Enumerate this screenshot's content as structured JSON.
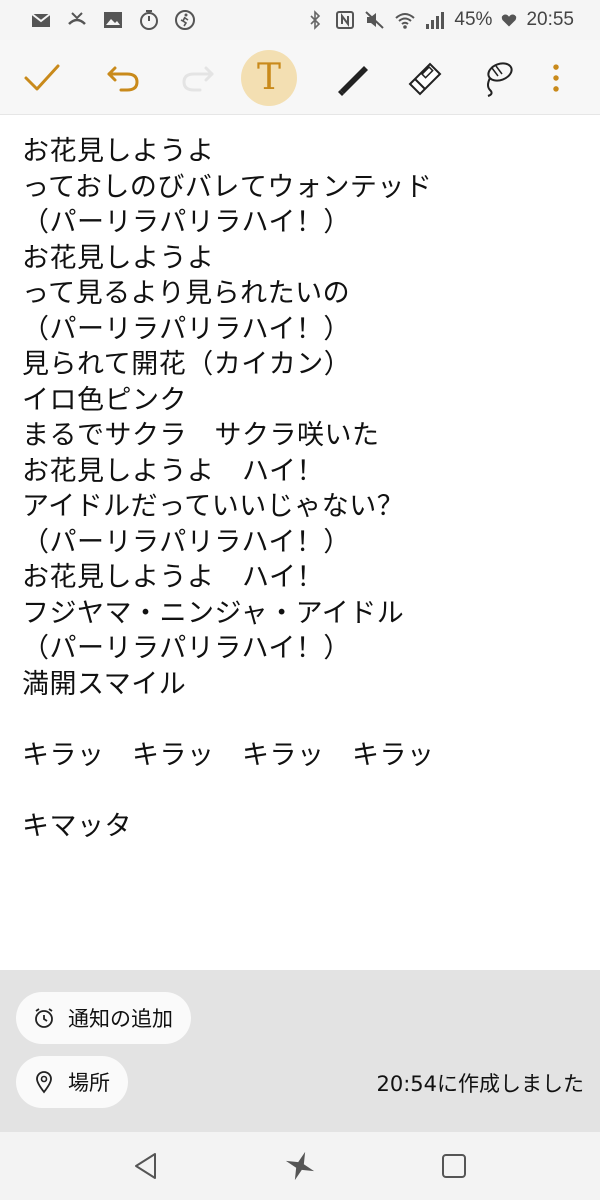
{
  "status_bar": {
    "battery_percent": "45%",
    "time": "20:55",
    "left_icons": [
      "mail-icon",
      "missed-call-icon",
      "image-icon",
      "timer-icon",
      "running-icon"
    ],
    "right_icons": [
      "bluetooth-icon",
      "nfc-icon",
      "mute-icon",
      "wifi-icon",
      "signal-icon",
      "battery-icon"
    ]
  },
  "toolbar": {
    "items": [
      "check-icon",
      "undo-icon",
      "redo-icon",
      "text-mode-icon",
      "pen-icon",
      "eraser-icon",
      "lasso-icon",
      "more-icon"
    ],
    "text_mode_glyph": "T",
    "accent": "#c98a1b",
    "active_bg": "#f3dfb2"
  },
  "note": {
    "lines": [
      "お花見しようよ",
      "っておしのびバレてウォンテッド",
      "（パーリラパリラハイ！）",
      "お花見しようよ",
      "って見るより見られたいの",
      "（パーリラパリラハイ！）",
      "見られて開花（カイカン）",
      "イロ色ピンク",
      "まるでサクラ　サクラ咲いた",
      "お花見しようよ　ハイ！",
      "アイドルだっていいじゃない？",
      "（パーリラパリラハイ！）",
      "お花見しようよ　ハイ！",
      "フジヤマ・ニンジャ・アイドル",
      "（パーリラパリラハイ！）",
      "満開スマイル",
      "",
      "キラッ　キラッ　キラッ　キラッ",
      "",
      "キマッタ"
    ]
  },
  "bottom_panel": {
    "add_notification": "通知の追加",
    "location": "場所",
    "created_text": "20:54に作成しました"
  },
  "nav_bar": {
    "items": [
      "back-icon",
      "home-icon",
      "recents-icon"
    ]
  }
}
